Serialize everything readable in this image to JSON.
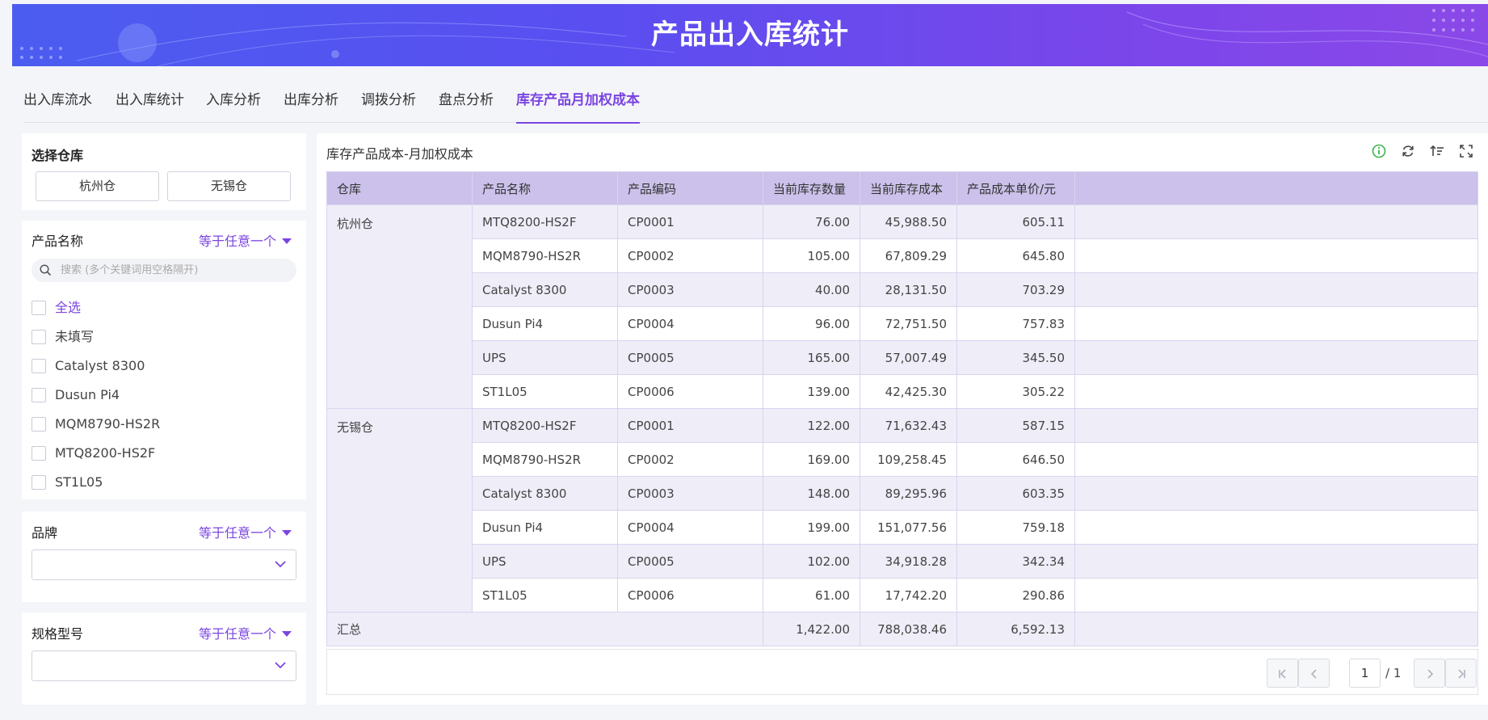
{
  "banner": {
    "title": "产品出入库统计"
  },
  "tabs": [
    {
      "label": "出入库流水"
    },
    {
      "label": "出入库统计"
    },
    {
      "label": "入库分析"
    },
    {
      "label": "出库分析"
    },
    {
      "label": "调拨分析"
    },
    {
      "label": "盘点分析"
    },
    {
      "label": "库存产品月加权成本",
      "active": true
    }
  ],
  "warehouse_filter": {
    "title": "选择仓库",
    "options": [
      "杭州仓",
      "无锡仓"
    ]
  },
  "product_filter": {
    "title": "产品名称",
    "mode": "等于任意一个",
    "search_placeholder": "搜索 (多个关键词用空格隔开)",
    "items": [
      "全选",
      "未填写",
      "Catalyst 8300",
      "Dusun Pi4",
      "MQM8790-HS2R",
      "MTQ8200-HS2F",
      "ST1L05"
    ]
  },
  "brand_filter": {
    "title": "品牌",
    "mode": "等于任意一个",
    "value": ""
  },
  "spec_filter": {
    "title": "规格型号",
    "mode": "等于任意一个",
    "value": ""
  },
  "table": {
    "title": "库存产品成本-月加权成本",
    "columns": [
      "仓库",
      "产品名称",
      "产品编码",
      "当前库存数量",
      "当前库存成本",
      "产品成本单价/元"
    ],
    "groups": [
      {
        "warehouse": "杭州仓",
        "rows": [
          [
            "MTQ8200-HS2F",
            "CP0001",
            "76.00",
            "45,988.50",
            "605.11"
          ],
          [
            "MQM8790-HS2R",
            "CP0002",
            "105.00",
            "67,809.29",
            "645.80"
          ],
          [
            "Catalyst 8300",
            "CP0003",
            "40.00",
            "28,131.50",
            "703.29"
          ],
          [
            "Dusun Pi4",
            "CP0004",
            "96.00",
            "72,751.50",
            "757.83"
          ],
          [
            "UPS",
            "CP0005",
            "165.00",
            "57,007.49",
            "345.50"
          ],
          [
            "ST1L05",
            "CP0006",
            "139.00",
            "42,425.30",
            "305.22"
          ]
        ]
      },
      {
        "warehouse": "无锡仓",
        "rows": [
          [
            "MTQ8200-HS2F",
            "CP0001",
            "122.00",
            "71,632.43",
            "587.15"
          ],
          [
            "MQM8790-HS2R",
            "CP0002",
            "169.00",
            "109,258.45",
            "646.50"
          ],
          [
            "Catalyst 8300",
            "CP0003",
            "148.00",
            "89,295.96",
            "603.35"
          ],
          [
            "Dusun Pi4",
            "CP0004",
            "199.00",
            "151,077.56",
            "759.18"
          ],
          [
            "UPS",
            "CP0005",
            "102.00",
            "34,918.28",
            "342.34"
          ],
          [
            "ST1L05",
            "CP0006",
            "61.00",
            "17,742.20",
            "290.86"
          ]
        ]
      }
    ],
    "total": {
      "label": "汇总",
      "qty": "1,422.00",
      "cost": "788,038.46",
      "unit": "6,592.13"
    }
  },
  "pager": {
    "current": "1",
    "total": "/ 1"
  },
  "colors": {
    "accent": "#7a45e0",
    "header_bg": "#cbc1ea",
    "stripe_bg": "#efedf8",
    "info_icon": "#3bb34a"
  }
}
